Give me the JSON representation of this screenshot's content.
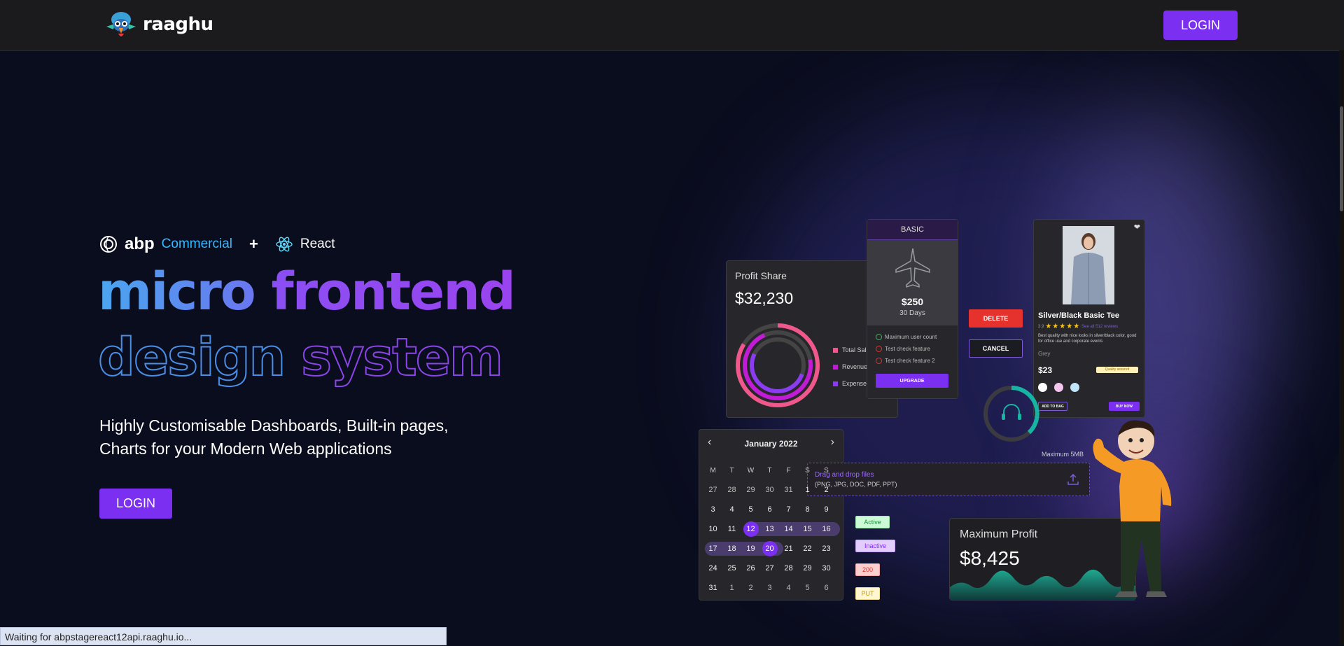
{
  "header": {
    "brand": "raaghu",
    "login_label": "LOGIN"
  },
  "hero": {
    "abp_word": "abp",
    "abp_commercial": "Commercial",
    "plus": "+",
    "react_label": "React",
    "headline": {
      "line1_word1": "micro",
      "line1_word2": "frontend",
      "line2_word1": "design",
      "line2_word2": "system"
    },
    "subtitle_line1": "Highly Customisable Dashboards, Built-in pages,",
    "subtitle_line2": "Charts for your Modern Web applications",
    "login_label": "LOGIN"
  },
  "showcase": {
    "profit_share": {
      "title": "Profit Share",
      "value": "$32,230",
      "legend": [
        {
          "label": "Total Sales",
          "color": "#f0588c"
        },
        {
          "label": "Revenue",
          "color": "#c21bd6"
        },
        {
          "label": "Expenses",
          "color": "#8b3cf0"
        }
      ]
    },
    "pricing": {
      "plan": "BASIC",
      "price": "$250",
      "period": "30 Days",
      "features": [
        {
          "label": "Maximum user count",
          "included": true
        },
        {
          "label": "Test check feature",
          "included": false
        },
        {
          "label": "Test check feature 2",
          "included": false
        }
      ],
      "upgrade_label": "UPGRADE"
    },
    "buttons": {
      "delete": "DELETE",
      "cancel": "CANCEL"
    },
    "product": {
      "title": "Silver/Black Basic Tee",
      "rating": "3.9",
      "reviews": "See all 512 reviews",
      "description": "Best quality with nice looks in silver/black color, good for office use and corporate events",
      "color": "Grey",
      "price": "$23",
      "badge": "Quality assured",
      "swatches": [
        "#ffffff",
        "#f4c6ee",
        "#bfe6fb"
      ],
      "add_to_bag": "ADD TO BAG",
      "buy_now": "BUY NOW"
    },
    "calendar": {
      "month": "January 2022",
      "weekdays": [
        "M",
        "T",
        "W",
        "T",
        "F",
        "S",
        "S"
      ],
      "weeks": [
        [
          "27",
          "28",
          "29",
          "30",
          "31",
          "1",
          "2"
        ],
        [
          "3",
          "4",
          "5",
          "6",
          "7",
          "8",
          "9"
        ],
        [
          "10",
          "11",
          "12",
          "13",
          "14",
          "15",
          "16"
        ],
        [
          "17",
          "18",
          "19",
          "20",
          "21",
          "22",
          "23"
        ],
        [
          "24",
          "25",
          "26",
          "27",
          "28",
          "29",
          "30"
        ],
        [
          "31",
          "1",
          "2",
          "3",
          "4",
          "5",
          "6"
        ]
      ],
      "selected_start": "12",
      "selected_end": "20"
    },
    "upload": {
      "max_size": "Maximum 5MB",
      "label": "Drag and drop files",
      "formats": "(PNG, JPG, DOC, PDF, PPT)"
    },
    "badges": {
      "active": "Active",
      "inactive": "Inactive",
      "code_200": "200",
      "put": "PUT"
    },
    "max_profit": {
      "title": "Maximum Profit",
      "value": "$8,425"
    }
  },
  "status_bar": {
    "text": "Waiting for abpstagereact12api.raaghu.io..."
  }
}
